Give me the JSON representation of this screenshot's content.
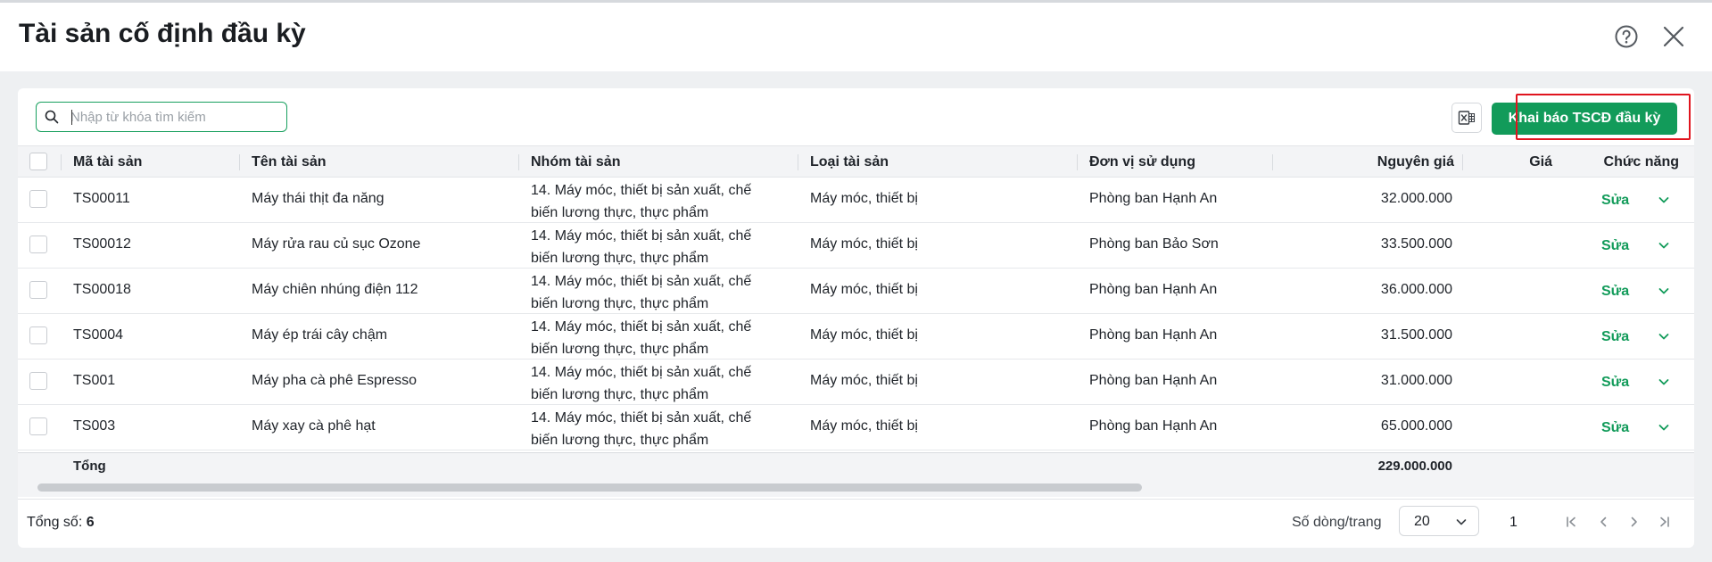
{
  "header": {
    "title": "Tài sản cố định đầu kỳ"
  },
  "toolbar": {
    "search_placeholder": "Nhập từ khóa tìm kiếm",
    "primary_button_label": "Khai báo TSCĐ đầu kỳ"
  },
  "table": {
    "columns": [
      "Mã tài sản",
      "Tên tài sản",
      "Nhóm tài sản",
      "Loại tài sản",
      "Đơn vị sử dụng",
      "Nguyên giá",
      "Giá",
      "Chức năng"
    ],
    "rows": [
      {
        "code": "TS00011",
        "name": "Máy thái thịt đa năng",
        "group_line1": "14. Máy móc, thiết bị sản xuất, chế",
        "group_line2": "biến lương thực, thực phẩm",
        "type": "Máy móc, thiết bị",
        "unit": "Phòng ban Hạnh An",
        "cost": "32.000.000",
        "action": "Sửa"
      },
      {
        "code": "TS00012",
        "name": "Máy rửa rau củ sục Ozone",
        "group_line1": "14. Máy móc, thiết bị sản xuất, chế",
        "group_line2": "biến lương thực, thực phẩm",
        "type": "Máy móc, thiết bị",
        "unit": "Phòng ban Bảo Sơn",
        "cost": "33.500.000",
        "action": "Sửa"
      },
      {
        "code": "TS00018",
        "name": "Máy chiên nhúng điện 112",
        "group_line1": "14. Máy móc, thiết bị sản xuất, chế",
        "group_line2": "biến lương thực, thực phẩm",
        "type": "Máy móc, thiết bị",
        "unit": "Phòng ban Hạnh An",
        "cost": "36.000.000",
        "action": "Sửa"
      },
      {
        "code": "TS0004",
        "name": "Máy ép trái cây chậm",
        "group_line1": "14. Máy móc, thiết bị sản xuất, chế",
        "group_line2": "biến lương thực, thực phẩm",
        "type": "Máy móc, thiết bị",
        "unit": "Phòng ban Hạnh An",
        "cost": "31.500.000",
        "action": "Sửa"
      },
      {
        "code": "TS001",
        "name": "Máy pha cà phê Espresso",
        "group_line1": "14. Máy móc, thiết bị sản xuất, chế",
        "group_line2": "biến lương thực, thực phẩm",
        "type": "Máy móc, thiết bị",
        "unit": "Phòng ban Hạnh An",
        "cost": "31.000.000",
        "action": "Sửa"
      },
      {
        "code": "TS003",
        "name": "Máy xay cà phê hạt",
        "group_line1": "14. Máy móc, thiết bị sản xuất, chế",
        "group_line2": "biến lương thực, thực phẩm",
        "type": "Máy móc, thiết bị",
        "unit": "Phòng ban Hạnh An",
        "cost": "65.000.000",
        "action": "Sửa"
      }
    ],
    "total_label": "Tổng",
    "total_cost": "229.000.000"
  },
  "footer": {
    "total_label": "Tổng số:",
    "total_count": "6",
    "rows_per_page_label": "Số dòng/trang",
    "rows_per_page_value": "20",
    "current_page": "1"
  },
  "colors": {
    "primary": "#129b5a",
    "highlight": "#e0141e"
  },
  "icons": {
    "help": "help-circle-icon",
    "close": "close-icon",
    "search": "search-icon",
    "excel": "excel-icon",
    "row_menu": "chevron-down-icon",
    "first_page": "first-page-icon",
    "prev_page": "prev-page-icon",
    "next_page": "next-page-icon",
    "last_page": "last-page-icon"
  }
}
